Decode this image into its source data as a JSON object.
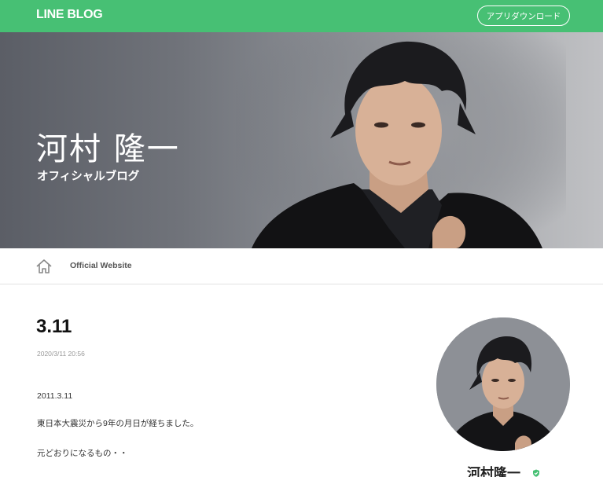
{
  "header": {
    "logo": "LINE BLOG",
    "app_download": "アプリダウンロード"
  },
  "hero": {
    "title": "河村 隆一",
    "subtitle": "オフィシャルブログ"
  },
  "nav": {
    "home_icon": "home-icon",
    "official_website": "Official Website"
  },
  "post": {
    "title": "3.11",
    "date": "2020/3/11 20:56",
    "lines": [
      "2011.3.11",
      "東日本大震災から9年の月日が経ちました。",
      "元どおりになるもの・・"
    ]
  },
  "sidebar": {
    "author_name": "河村隆一",
    "verified_icon": "verified-shield-icon"
  },
  "colors": {
    "brand_green": "#47c074",
    "text_dark": "#222222",
    "date_grey": "#999999"
  }
}
